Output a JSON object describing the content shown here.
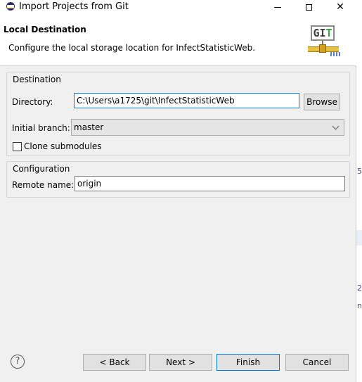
{
  "window": {
    "title": "Import Projects from Git",
    "minimize_glyph": "—",
    "maximize_glyph": "☐",
    "close_glyph": "✕"
  },
  "header": {
    "title": "Local Destination",
    "description": "Configure the local storage location for InfectStatisticWeb.",
    "logo_text_g": "G",
    "logo_text_i": "I",
    "logo_text_t": "T"
  },
  "destination": {
    "group_label": "Destination",
    "directory_label": "Directory:",
    "directory_value": "C:\\Users\\a1725\\git\\InfectStatisticWeb",
    "browse_label": "Browse",
    "branch_label": "Initial branch:",
    "branch_value": "master",
    "clone_submodules_label": "Clone submodules",
    "clone_submodules_checked": false
  },
  "configuration": {
    "group_label": "Configuration",
    "remote_label": "Remote name:",
    "remote_value": "origin"
  },
  "footer": {
    "help_glyph": "?",
    "back_label": "< Back",
    "next_label": "Next >",
    "finish_label": "Finish",
    "cancel_label": "Cancel"
  },
  "background_marks": [
    "5",
    "2",
    "n"
  ],
  "colors": {
    "focus_border": "#0078d7",
    "button_face": "#e1e1e1",
    "dialog_bg": "#f0f0f0",
    "side_text": "#5a3e9a"
  }
}
